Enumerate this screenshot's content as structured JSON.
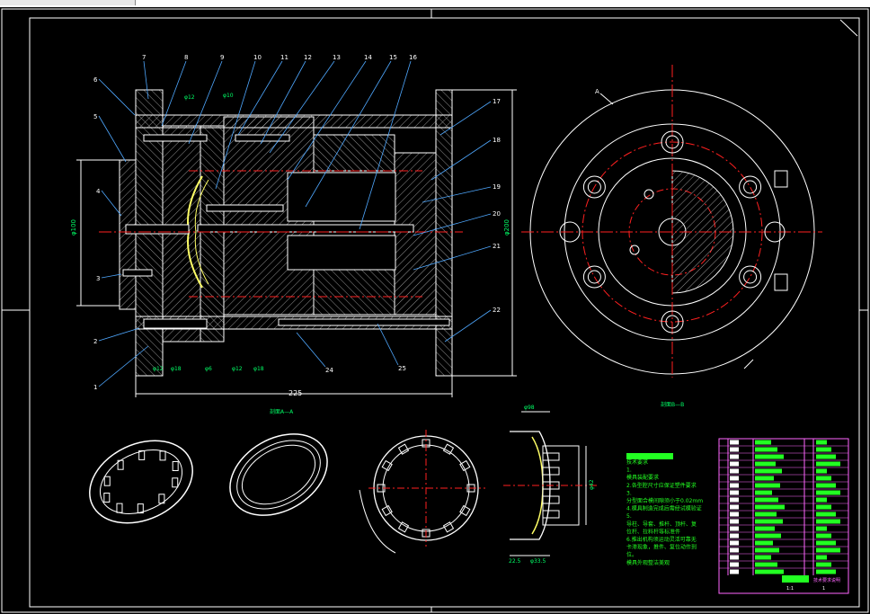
{
  "colors": {
    "background": "#000000",
    "line": "#ffffff",
    "dim": "#00ff66",
    "hatch": "#ffffff",
    "center": "#ff2020",
    "leader": "#4fa8ff",
    "label": "#00ff66",
    "block": "#22ff22",
    "titleblock": "#ff66ff",
    "yellow": "#ffff66"
  },
  "section_a": {
    "part_numbers_top": [
      "7",
      "8",
      "9",
      "10",
      "11",
      "12",
      "13",
      "14",
      "15",
      "16"
    ],
    "part_numbers_right": [
      "17",
      "18",
      "19",
      "20",
      "21",
      "22"
    ],
    "part_numbers_left": [
      "6",
      "5",
      "4",
      "3",
      "2",
      "1"
    ],
    "part_numbers_bottom": [
      "24",
      "25"
    ],
    "dim_overall_width": "225",
    "dim_left_height": "φ100",
    "dim_right_height": "φ200",
    "bottom_dims": [
      "φ12",
      "φ18",
      "φ6",
      "φ12",
      "φ18"
    ],
    "top_dims": [
      "φ12",
      "φ10"
    ],
    "caption": "剖面A—A"
  },
  "section_b": {
    "marker": "A",
    "caption": "剖面B—B"
  },
  "part_view": {
    "dims_top": "φ98",
    "dims_right": "φ42",
    "dims_bottom": [
      "22.5",
      "φ33.5"
    ]
  },
  "notes": [
    "技术要求",
    "1.",
    "模具装配要求",
    "2.各型腔尺寸应保证塑件要求",
    "3.",
    "分型面合模间隙须小于0.02mm",
    "4.模具制造完成后需经试模验证",
    "5.",
    "导柱、导套、推杆、顶杆、复",
    "位杆、拉料杆等标准件",
    "6.推出机构须运动灵活可靠无",
    "卡滞现象，推件、复位动作到",
    "位。",
    "模具外观整洁美观"
  ],
  "title_block": {
    "label": "技术要求说明",
    "scale": "1:1",
    "sheet": "1"
  }
}
